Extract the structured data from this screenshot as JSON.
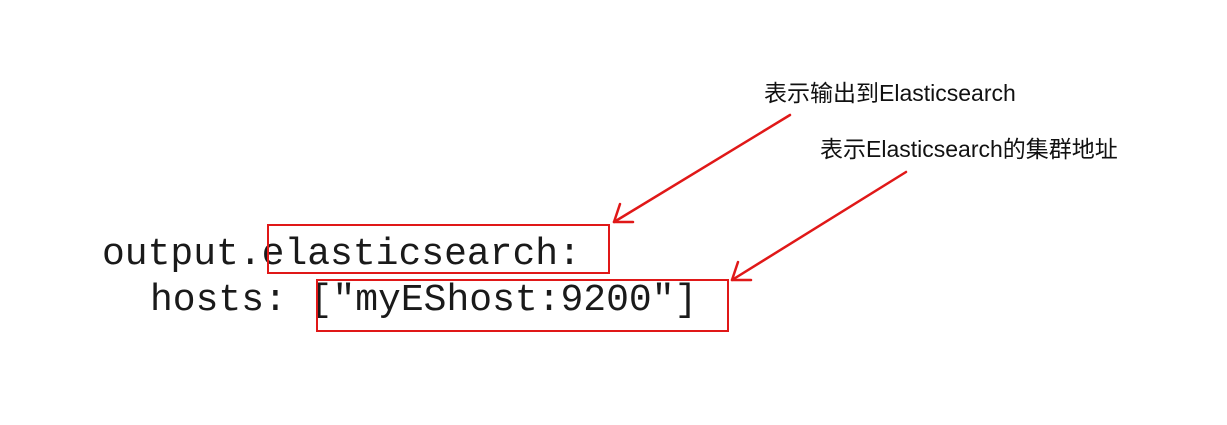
{
  "code": {
    "line1_prefix": "output.",
    "line1_key": "elasticsearch:",
    "line2_prefix": "hosts: ",
    "line2_value": "[\"myEShost:9200\"]"
  },
  "annotations": {
    "output_note": "表示输出到Elasticsearch",
    "hosts_note": "表示Elasticsearch的集群地址"
  },
  "colors": {
    "highlight": "#e01818",
    "text": "#1a1a1a"
  }
}
